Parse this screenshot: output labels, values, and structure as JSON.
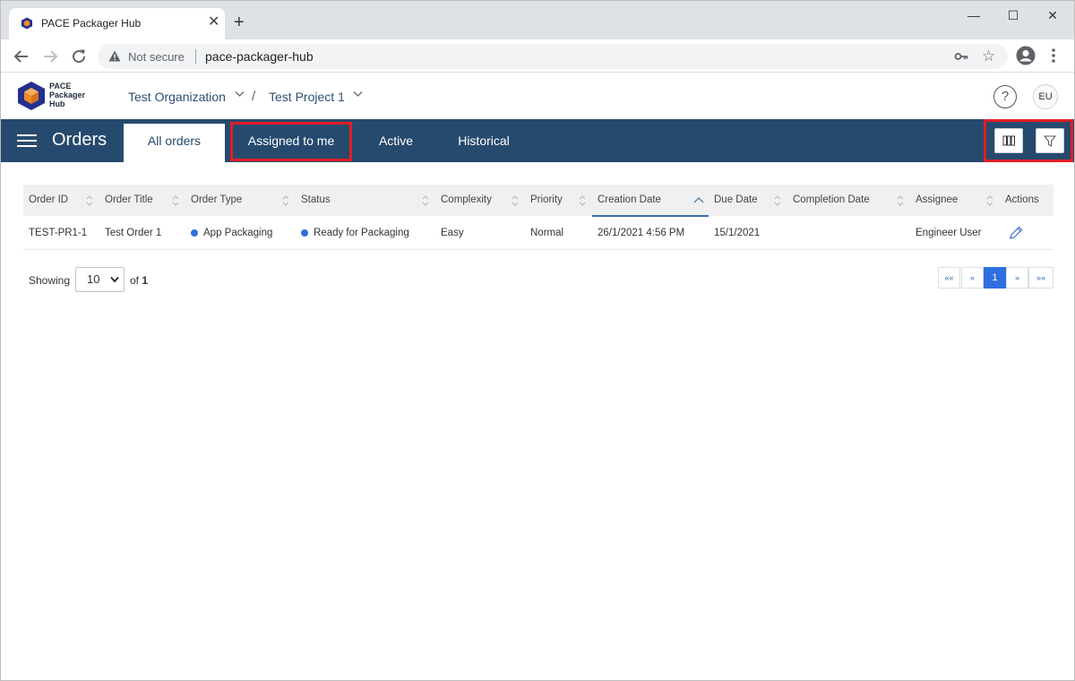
{
  "browser": {
    "tab_title": "PACE Packager Hub",
    "tab_close": "✕",
    "new_tab": "+",
    "security_label": "Not secure",
    "url": "pace-packager-hub",
    "window_min": "—",
    "window_max": "☐",
    "window_close": "✕"
  },
  "app": {
    "logo_line1": "PACE",
    "logo_line2": "Packager",
    "logo_line3": "Hub",
    "org": "Test Organization",
    "separator": "/",
    "project": "Test Project 1",
    "help": "?",
    "user_initials": "EU"
  },
  "toolbar": {
    "title": "Orders",
    "tabs": [
      {
        "label": "All orders",
        "active": true
      },
      {
        "label": "Assigned to me",
        "active": false
      },
      {
        "label": "Active",
        "active": false
      },
      {
        "label": "Historical",
        "active": false
      }
    ]
  },
  "table": {
    "columns": [
      "Order ID",
      "Order Title",
      "Order Type",
      "Status",
      "Complexity",
      "Priority",
      "Creation Date",
      "Due Date",
      "Completion Date",
      "Assignee",
      "Actions"
    ],
    "rows": [
      {
        "order_id": "TEST-PR1-1",
        "title": "Test Order 1",
        "type": "App Packaging",
        "status": "Ready for Packaging",
        "complexity": "Easy",
        "priority": "Normal",
        "creation_date": "26/1/2021 4:56 PM",
        "due_date": "15/1/2021",
        "completion_date": "",
        "assignee": "Engineer User"
      }
    ]
  },
  "pagination": {
    "showing_label": "Showing",
    "page_size": "10",
    "of_label": "of",
    "total_pages": "1",
    "first": "««",
    "prev": "«",
    "current": "1",
    "next": "»",
    "last": "»»"
  },
  "colors": {
    "toolbar_bg": "#264a6e",
    "highlight": "#e11e26",
    "status_dot": "#2f6fe0"
  }
}
